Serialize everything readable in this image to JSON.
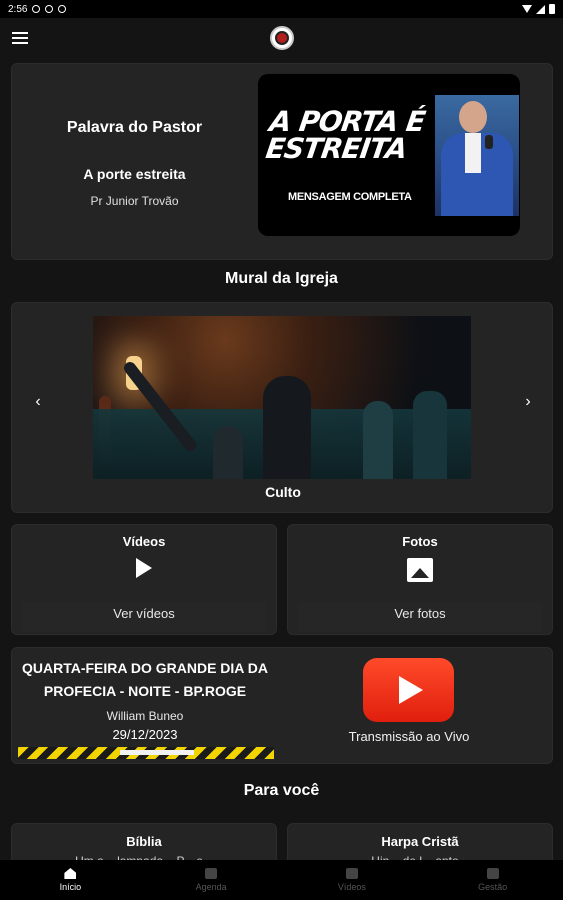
{
  "status_bar": {
    "time": "2:56"
  },
  "pastor_card": {
    "title": "Palavra do Pastor",
    "message": "A porte estreita",
    "author": "Pr Junior Trovão",
    "thumbnail": {
      "headline": "A PORTA É ESTREITA",
      "subtitle": "MENSAGEM COMPLETA"
    }
  },
  "mural": {
    "section_title": "Mural da Igreja",
    "caption": "Culto",
    "prev_icon": "chevron-left-icon",
    "next_icon": "chevron-right-icon"
  },
  "videos": {
    "title": "Vídeos",
    "button": "Ver vídeos",
    "icon": "play-icon"
  },
  "photos": {
    "title": "Fotos",
    "button": "Ver fotos",
    "icon": "image-icon"
  },
  "live": {
    "title": "QUARTA-FEIRA DO GRANDE DIA DA PROFECIA - NOITE - BP.ROGE",
    "name": "William Buneo",
    "date": "29/12/2023",
    "label": "Transmissão ao Vivo",
    "icon": "youtube-play-icon",
    "accent": "#e01f0d"
  },
  "for_you": {
    "section_title": "Para você",
    "cards": [
      {
        "title": "Bíblia",
        "text": "Um a... lampada... P... e..."
      },
      {
        "title": "Harpa Cristã",
        "text": "Hin... de l... anto..."
      }
    ]
  },
  "nav": [
    {
      "label": "Início",
      "active": true,
      "icon": "home-icon"
    },
    {
      "label": "Agenda",
      "active": false,
      "icon": "calendar-icon"
    },
    {
      "label": "Vídeos",
      "active": false,
      "icon": "video-icon"
    },
    {
      "label": "Gestão",
      "active": false,
      "icon": "more-icon"
    }
  ]
}
